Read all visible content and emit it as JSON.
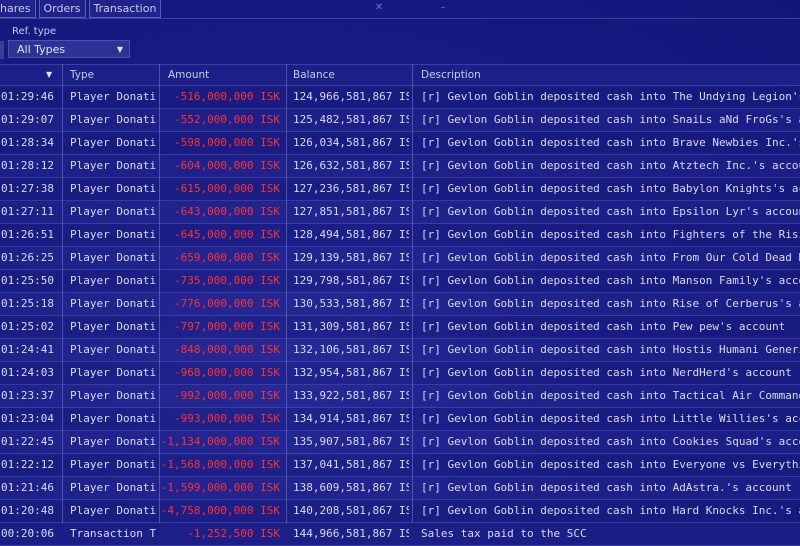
{
  "tabs": [
    "hares",
    "Orders",
    "Transaction"
  ],
  "filter": {
    "label": "Ref. type",
    "value": "All Types"
  },
  "columns": [
    "",
    "Type",
    "Amount",
    "Balance",
    "Description"
  ],
  "rows": [
    {
      "time": "01:29:46",
      "type": "Player Donatio",
      "amount": "-516,000,000 ISK",
      "balance": "124,966,581,867 IS",
      "desc": "[r] Gevlon Goblin deposited cash into The Undying Legion's accou"
    },
    {
      "time": "01:29:07",
      "type": "Player Donatio",
      "amount": "-552,000,000 ISK",
      "balance": "125,482,581,867 IS",
      "desc": "[r] Gevlon Goblin deposited cash into SnaiLs aNd FroGs's account"
    },
    {
      "time": "01:28:34",
      "type": "Player Donatio",
      "amount": "-598,000,000 ISK",
      "balance": "126,034,581,867 IS",
      "desc": "[r] Gevlon Goblin deposited cash into Brave Newbies Inc.'s accou"
    },
    {
      "time": "01:28:12",
      "type": "Player Donatio",
      "amount": "-604,000,000 ISK",
      "balance": "126,632,581,867 IS",
      "desc": "[r] Gevlon Goblin deposited cash into Atztech Inc.'s account"
    },
    {
      "time": "01:27:38",
      "type": "Player Donatio",
      "amount": "-615,000,000 ISK",
      "balance": "127,236,581,867 IS",
      "desc": "[r] Gevlon Goblin deposited cash into Babylon Knights's account"
    },
    {
      "time": "01:27:11",
      "type": "Player Donatio",
      "amount": "-643,000,000 ISK",
      "balance": "127,851,581,867 IS",
      "desc": "[r] Gevlon Goblin deposited cash into Epsilon Lyr's account"
    },
    {
      "time": "01:26:51",
      "type": "Player Donatio",
      "amount": "-645,000,000 ISK",
      "balance": "128,494,581,867 IS",
      "desc": "[r] Gevlon Goblin deposited cash into Fighters of the Rising Sun'"
    },
    {
      "time": "01:26:25",
      "type": "Player Donatio",
      "amount": "-659,000,000 ISK",
      "balance": "129,139,581,867 IS",
      "desc": "[r] Gevlon Goblin deposited cash into From Our Cold Dead Hands"
    },
    {
      "time": "01:25:50",
      "type": "Player Donatio",
      "amount": "-735,000,000 ISK",
      "balance": "129,798,581,867 IS",
      "desc": "[r] Gevlon Goblin deposited cash into Manson Family's account"
    },
    {
      "time": "01:25:18",
      "type": "Player Donatio",
      "amount": "-776,000,000 ISK",
      "balance": "130,533,581,867 IS",
      "desc": "[r] Gevlon Goblin deposited cash into Rise of Cerberus's account"
    },
    {
      "time": "01:25:02",
      "type": "Player Donatio",
      "amount": "-797,000,000 ISK",
      "balance": "131,309,581,867 IS",
      "desc": "[r] Gevlon Goblin deposited cash into Pew pew's account"
    },
    {
      "time": "01:24:41",
      "type": "Player Donatio",
      "amount": "-848,000,000 ISK",
      "balance": "132,106,581,867 IS",
      "desc": "[r] Gevlon Goblin deposited cash into Hostis Humani Generis.'s a"
    },
    {
      "time": "01:24:03",
      "type": "Player Donatio",
      "amount": "-968,000,000 ISK",
      "balance": "132,954,581,867 IS",
      "desc": "[r] Gevlon Goblin deposited cash into NerdHerd's account"
    },
    {
      "time": "01:23:37",
      "type": "Player Donatio",
      "amount": "-992,000,000 ISK",
      "balance": "133,922,581,867 IS",
      "desc": "[r] Gevlon Goblin deposited cash into Tactical Air Command's acc"
    },
    {
      "time": "01:23:04",
      "type": "Player Donatio",
      "amount": "-993,000,000 ISK",
      "balance": "134,914,581,867 IS",
      "desc": "[r] Gevlon Goblin deposited cash into Little Willies's account"
    },
    {
      "time": "01:22:45",
      "type": "Player Donatio",
      "amount": "-1,134,000,000 ISK",
      "balance": "135,907,581,867 IS",
      "desc": "[r] Gevlon Goblin deposited cash into Cookies Squad's account"
    },
    {
      "time": "01:22:12",
      "type": "Player Donatio",
      "amount": "-1,568,000,000 ISK",
      "balance": "137,041,581,867 IS",
      "desc": "[r] Gevlon Goblin deposited cash into Everyone vs Everything's a"
    },
    {
      "time": "01:21:46",
      "type": "Player Donatio",
      "amount": "-1,599,000,000 ISK",
      "balance": "138,609,581,867 IS",
      "desc": "[r] Gevlon Goblin deposited cash into AdAstra.'s account"
    },
    {
      "time": "01:20:48",
      "type": "Player Donatio",
      "amount": "-4,758,000,000 ISK",
      "balance": "140,208,581,867 IS",
      "desc": "[r] Gevlon Goblin deposited cash into Hard Knocks Inc.'s account"
    },
    {
      "time": "00:20:06",
      "type": "Transaction Ta",
      "amount": "-1,252,500 ISK",
      "balance": "144,966,581,867 IS",
      "desc": "Sales tax paid to the SCC"
    }
  ]
}
